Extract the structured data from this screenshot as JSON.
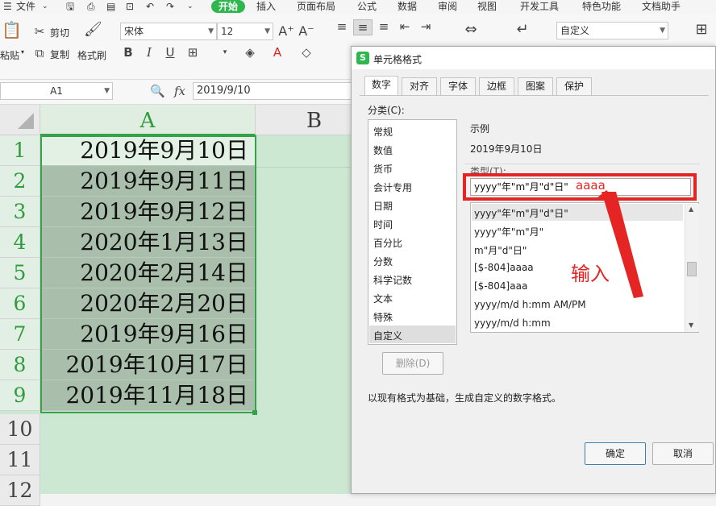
{
  "menubar": {
    "file": "文件",
    "tabs": [
      "开始",
      "插入",
      "页面布局",
      "公式",
      "数据",
      "审阅",
      "视图",
      "开发工具",
      "特色功能",
      "文档助手"
    ]
  },
  "ribbon": {
    "paste": "粘贴",
    "cut": "剪切",
    "copy": "复制",
    "format_painter": "格式刷",
    "font_name": "宋体",
    "font_size": "12",
    "number_format": "自定义"
  },
  "formula_bar": {
    "name_box": "A1",
    "fx": "fx",
    "value": "2019/9/10"
  },
  "sheet": {
    "columns": [
      "A",
      "B"
    ],
    "rows": [
      "1",
      "2",
      "3",
      "4",
      "5",
      "6",
      "7",
      "8",
      "9",
      "10",
      "11",
      "12"
    ],
    "cells": [
      "2019年9月10日",
      "2019年9月11日",
      "2019年9月12日",
      "2020年1月13日",
      "2020年2月14日",
      "2020年2月20日",
      "2019年9月16日",
      "2019年10月17日",
      "2019年11月18日"
    ]
  },
  "dialog": {
    "title": "单元格格式",
    "tabs": [
      "数字",
      "对齐",
      "字体",
      "边框",
      "图案",
      "保护"
    ],
    "category_label": "分类(C):",
    "categories": [
      "常规",
      "数值",
      "货币",
      "会计专用",
      "日期",
      "时间",
      "百分比",
      "分数",
      "科学记数",
      "文本",
      "特殊",
      "自定义"
    ],
    "sample_label": "示例",
    "sample_value": "2019年9月10日",
    "type_label": "类型(T):",
    "type_value": "yyyy\"年\"m\"月\"d\"日\"",
    "formats": [
      "yyyy\"年\"m\"月\"d\"日\"",
      "yyyy\"年\"m\"月\"",
      "m\"月\"d\"日\"",
      "[$-804]aaaa",
      "[$-804]aaa",
      "yyyy/m/d h:mm AM/PM",
      "yyyy/m/d h:mm"
    ],
    "delete_button": "删除(D)",
    "hint": "以现有格式为基础，生成自定义的数字格式。",
    "ok_button": "确定",
    "cancel_button": "取消"
  },
  "annotation": {
    "typed_text": "aaaa",
    "label": "输入",
    "color": "#e52424"
  },
  "colors": {
    "accent_green": "#2fb74e",
    "selection_green": "#35a24a"
  }
}
